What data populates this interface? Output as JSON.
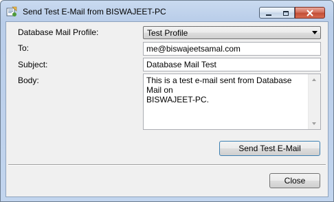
{
  "window": {
    "title": "Send Test E-Mail from BISWAJEET-PC"
  },
  "form": {
    "profile_label": "Database Mail Profile:",
    "profile_value": "Test Profile",
    "to_label": "To:",
    "to_value": "me@biswajeetsamal.com",
    "subject_label": "Subject:",
    "subject_value": "Database Mail Test",
    "body_label": "Body:",
    "body_line1": "This is a test e-mail sent from Database Mail on",
    "body_line2": "BISWAJEET-PC."
  },
  "buttons": {
    "send_label": "Send Test E-Mail",
    "close_label": "Close"
  },
  "colors": {
    "accent": "#3c7fb1",
    "close_red": "#c24e37"
  }
}
